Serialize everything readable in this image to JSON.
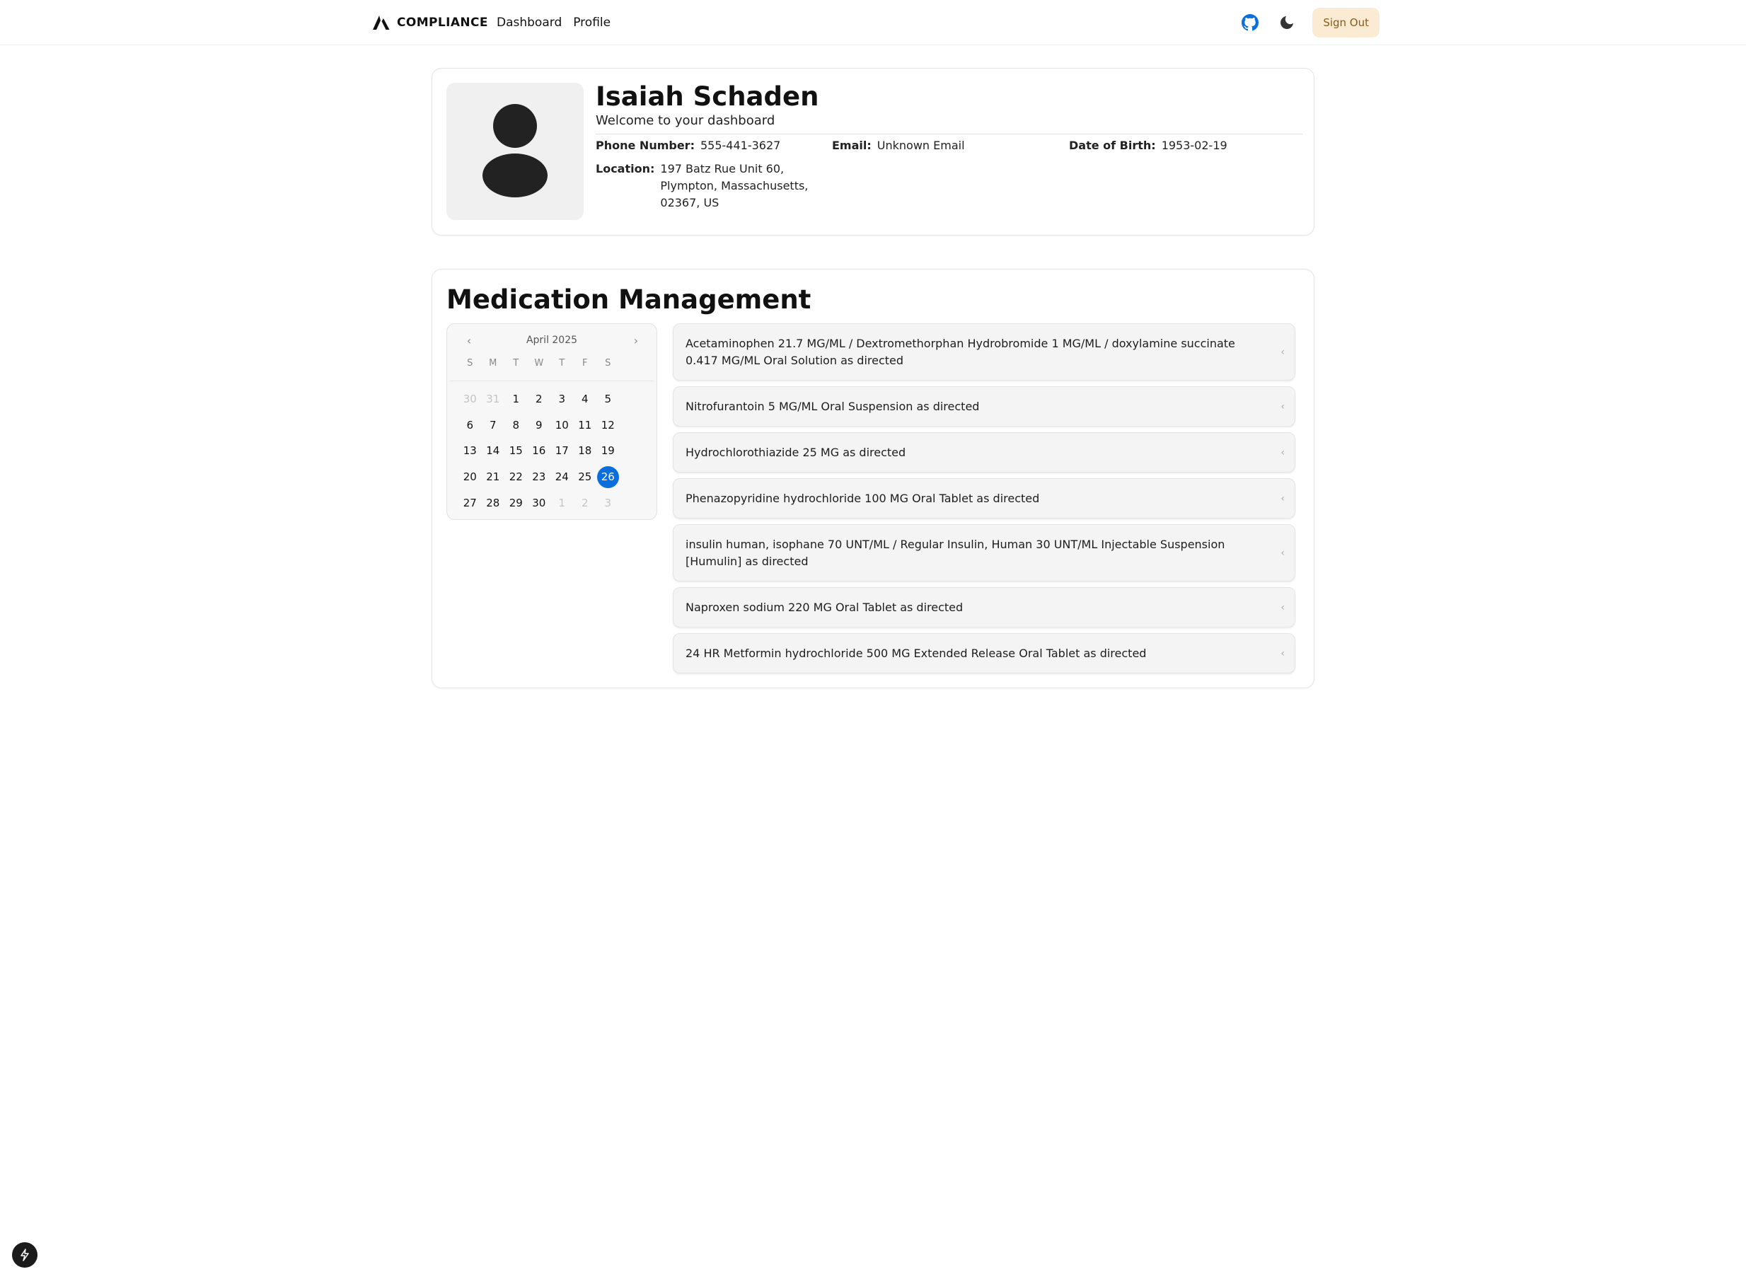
{
  "nav": {
    "brand": "COMPLIANCE",
    "links": [
      "Dashboard",
      "Profile"
    ],
    "signout_label": "Sign Out",
    "icons": [
      "triangle-logo-icon",
      "github-icon",
      "moon-icon"
    ]
  },
  "profile": {
    "name": "Isaiah Schaden",
    "welcome": "Welcome to your dashboard",
    "phone_label": "Phone Number:",
    "phone": "555-441-3627",
    "email_label": "Email:",
    "email": "Unknown Email",
    "dob_label": "Date of Birth:",
    "dob": "1953-02-19",
    "location_label": "Location:",
    "location": "197 Batz Rue Unit 60, Plympton, Massachusetts, 02367, US",
    "avatar_icon": "user-silhouette-icon"
  },
  "medication": {
    "title": "Medication Management",
    "calendar": {
      "month_label": "April 2025",
      "weekdays": [
        "S",
        "M",
        "T",
        "W",
        "T",
        "F",
        "S"
      ],
      "days": [
        {
          "d": "30",
          "muted": true
        },
        {
          "d": "31",
          "muted": true
        },
        {
          "d": "1"
        },
        {
          "d": "2"
        },
        {
          "d": "3"
        },
        {
          "d": "4"
        },
        {
          "d": "5"
        },
        {
          "d": "6"
        },
        {
          "d": "7"
        },
        {
          "d": "8"
        },
        {
          "d": "9"
        },
        {
          "d": "10"
        },
        {
          "d": "11"
        },
        {
          "d": "12"
        },
        {
          "d": "13"
        },
        {
          "d": "14"
        },
        {
          "d": "15"
        },
        {
          "d": "16"
        },
        {
          "d": "17"
        },
        {
          "d": "18"
        },
        {
          "d": "19"
        },
        {
          "d": "20"
        },
        {
          "d": "21"
        },
        {
          "d": "22"
        },
        {
          "d": "23"
        },
        {
          "d": "24"
        },
        {
          "d": "25"
        },
        {
          "d": "26",
          "selected": true
        },
        {
          "d": "27"
        },
        {
          "d": "28"
        },
        {
          "d": "29"
        },
        {
          "d": "30"
        },
        {
          "d": "1",
          "muted": true
        },
        {
          "d": "2",
          "muted": true
        },
        {
          "d": "3",
          "muted": true
        }
      ],
      "selected_color": "#0a6edc"
    },
    "items": [
      "Acetaminophen 21.7 MG/ML / Dextromethorphan Hydrobromide 1 MG/ML / doxylamine succinate 0.417 MG/ML Oral Solution as directed",
      "Nitrofurantoin 5 MG/ML Oral Suspension as directed",
      "Hydrochlorothiazide 25 MG as directed",
      "Phenazopyridine hydrochloride 100 MG Oral Tablet as directed",
      "insulin human, isophane 70 UNT/ML / Regular Insulin, Human 30 UNT/ML Injectable Suspension [Humulin] as directed",
      "Naproxen sodium 220 MG Oral Tablet as directed",
      "24 HR Metformin hydrochloride 500 MG Extended Release Oral Tablet as directed"
    ]
  },
  "colors": {
    "accent": "#0a6edc",
    "signout_bg": "#fbebd3",
    "signout_text": "#8a5a16",
    "github": "#0a6edc"
  }
}
